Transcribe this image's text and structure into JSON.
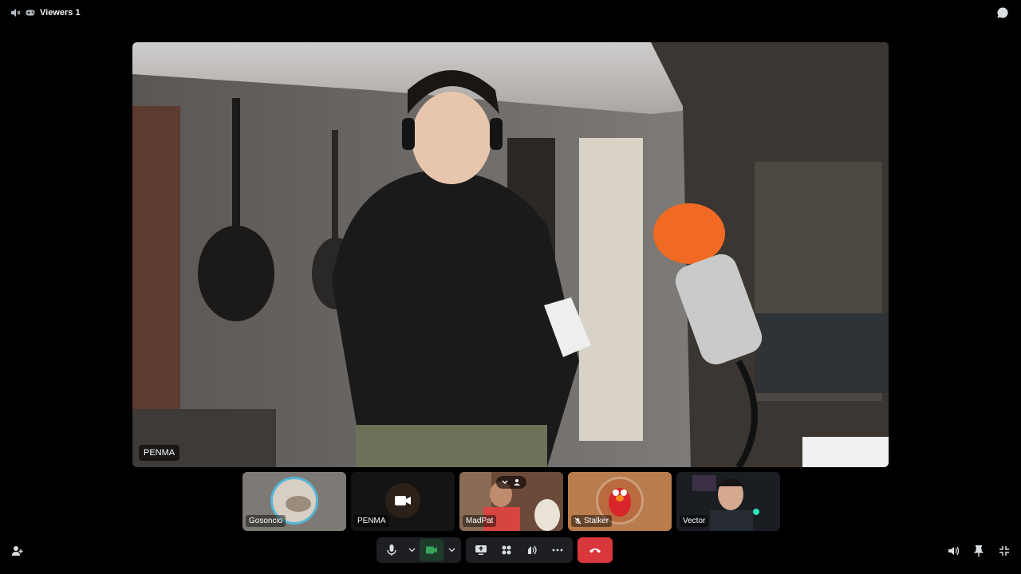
{
  "topbar": {
    "viewers_label": "Viewers 1",
    "speaker_icon": "speaker-muted-icon",
    "gamepad_icon": "gamepad-icon",
    "chat_icon": "chat-bubble-icon"
  },
  "stage": {
    "participant_name": "PENMA"
  },
  "tiles": [
    {
      "name": "Gosoncio",
      "state": "avatar"
    },
    {
      "name": "PENMA",
      "state": "camera-placeholder"
    },
    {
      "name": "MadPat",
      "state": "video",
      "speaking": true
    },
    {
      "name": "Stalker",
      "state": "avatar",
      "muted": true
    },
    {
      "name": "Vector",
      "state": "video"
    }
  ],
  "controls": {
    "mic_icon": "microphone-icon",
    "camera_icon": "video-camera-icon",
    "screen_share_icon": "screen-share-icon",
    "activities_icon": "activities-icon",
    "soundboard_icon": "soundboard-icon",
    "more_icon": "more-icon",
    "hangup_icon": "phone-hangup-icon"
  },
  "bottom": {
    "invite_icon": "add-person-icon",
    "volume_icon": "volume-icon",
    "pin_icon": "pin-icon",
    "exit_fullscreen_icon": "exit-fullscreen-icon"
  },
  "colors": {
    "accent_green": "#3ba55d",
    "hangup_red": "#da373c",
    "panel": "#1e1f22"
  }
}
